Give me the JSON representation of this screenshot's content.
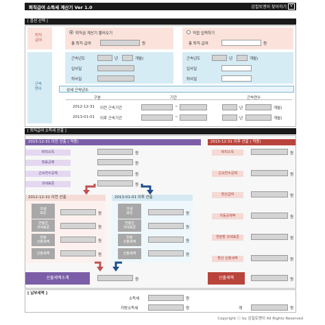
{
  "header": {
    "title": "퇴직급여 소득세 계산기 Ver 1.0",
    "link": "감칠토맹이 찾아하기",
    "logo": "LOGO"
  },
  "option_section": {
    "title": "[ 옵션 선택 ]",
    "pay_label": "퇴직\n급여",
    "service_label": "근속\n연수",
    "left_radio": "퇴직금 계산기 불러오기",
    "right_radio": "직접 입력하기",
    "total_pay_label": "총 퇴직 급여",
    "won": "원",
    "service_years_label": "근속년도",
    "year_unit": "년",
    "month_unit": "개월)",
    "join_label": "입사일",
    "leave_label": "퇴사일",
    "detail_title": "상세 근속년수",
    "col_type": "구분",
    "col_period": "기간",
    "col_years": "근속연수",
    "row1_date": "2012-12-31",
    "row1_label": "이전 근속기간",
    "row2_date": "2013-01-01",
    "row2_label": "이후 근속기간",
    "tilde": "~"
  },
  "calc_section": {
    "title": "[ 퇴직급여 소득세 산출 ]",
    "left_header": "2015-12-31   이전 산출              (          적용)",
    "right_header": "2015-12-31   이후 산출      (      적용)",
    "left_items": [
      "퇴직소득",
      "정률공제",
      "근속연수공제",
      "과세표준"
    ],
    "right_items": [
      "퇴직소득",
      "근속연수공제",
      "환산급여",
      "차등공제액",
      "연분할 과세표준",
      "환산 산출세액"
    ],
    "sub_left_header": "2012-12-31  이전 산출",
    "sub_right_header": "2013-01-01  이후 산출",
    "sub_items": [
      "과세\n표준",
      "연평균\n과세표준",
      "연분\n산출세액",
      "산출세액"
    ],
    "left_total": "산출세액소계",
    "right_total": "산출세액",
    "won": "원"
  },
  "tax_section": {
    "title": "[ 납부세액 ]",
    "income_tax": "소득세",
    "local_tax": "지방소득세",
    "total": "계",
    "won": "원"
  },
  "footer": {
    "copyright": "Copyright ⓒ by 감칠토맹이 All Rights Reserved"
  },
  "colors": {
    "purple": "#7b5ea7",
    "red": "#b9443c",
    "pink": "#fbe3dc",
    "blue": "#d6ecf5"
  }
}
